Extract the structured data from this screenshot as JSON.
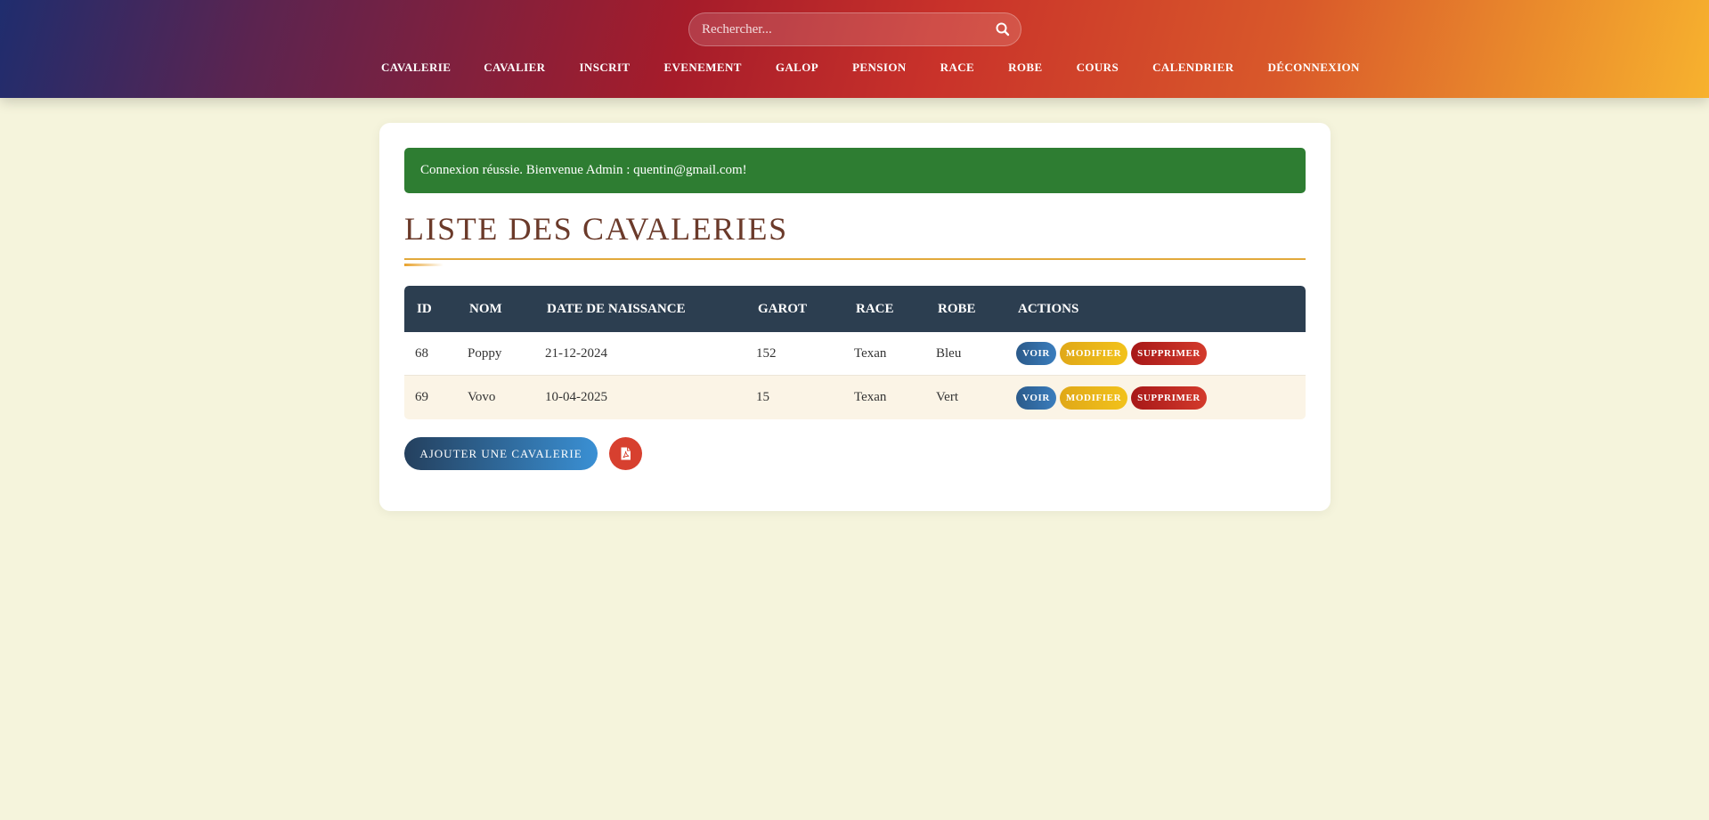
{
  "header": {
    "search": {
      "placeholder": "Rechercher...",
      "value": ""
    },
    "nav": [
      {
        "label": "CAVALERIE"
      },
      {
        "label": "CAVALIER"
      },
      {
        "label": "INSCRIT"
      },
      {
        "label": "EVENEMENT"
      },
      {
        "label": "GALOP"
      },
      {
        "label": "PENSION"
      },
      {
        "label": "RACE"
      },
      {
        "label": "ROBE"
      },
      {
        "label": "COURS"
      },
      {
        "label": "CALENDRIER"
      },
      {
        "label": "DÉCONNEXION"
      }
    ]
  },
  "main": {
    "alert": "Connexion réussie. Bienvenue Admin : quentin@gmail.com!",
    "title": "LISTE DES CAVALERIES",
    "table": {
      "headers": [
        "ID",
        "NOM",
        "DATE DE NAISSANCE",
        "GAROT",
        "RACE",
        "ROBE",
        "ACTIONS"
      ],
      "rows": [
        {
          "id": "68",
          "nom": "Poppy",
          "date": "21-12-2024",
          "garot": "152",
          "race": "Texan",
          "robe": "Bleu"
        },
        {
          "id": "69",
          "nom": "Vovo",
          "date": "10-04-2025",
          "garot": "15",
          "race": "Texan",
          "robe": "Vert"
        }
      ],
      "actions": {
        "voir": "VOIR",
        "modifier": "MODIFIER",
        "supprimer": "SUPPRIMER"
      }
    },
    "add_button": "AJOUTER UNE CAVALERIE",
    "pdf_icon": "file-pdf-icon"
  },
  "colors": {
    "alert": "#2e7d32",
    "table_header": "#2c3e50",
    "title": "#6b3a2a",
    "voir": "#2b5a8a",
    "modifier": "#e0a818",
    "supprimer": "#a71818"
  }
}
